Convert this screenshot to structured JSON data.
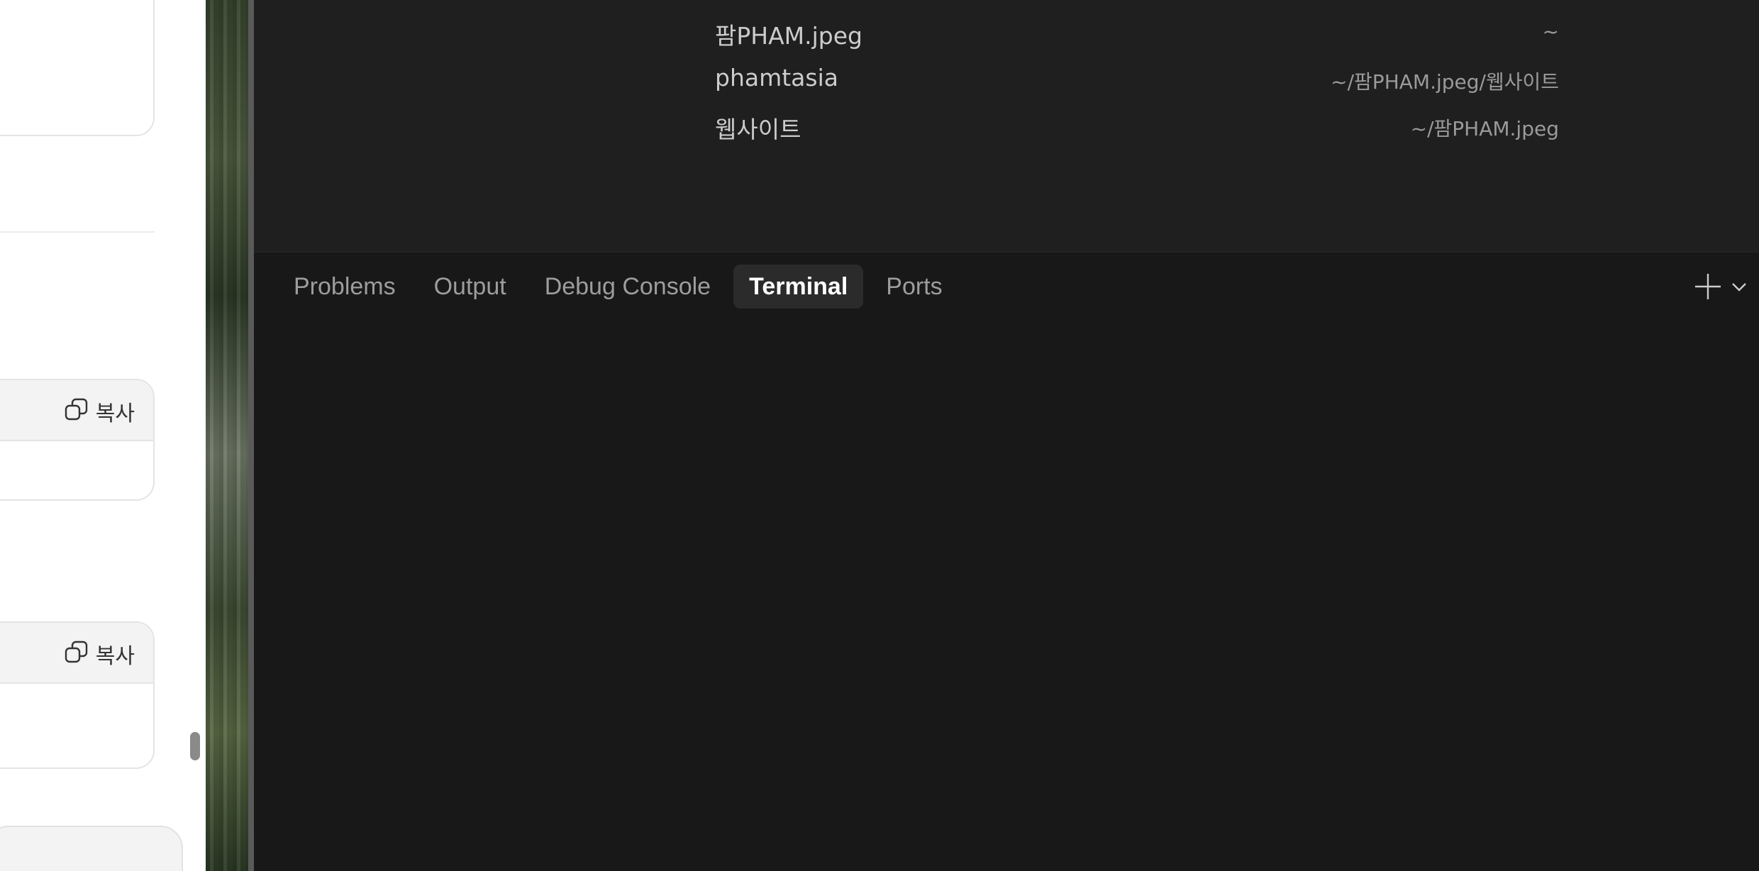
{
  "left_pane": {
    "code_blocks": [
      {
        "copy_label": "복사",
        "icon": "copy-icon"
      },
      {
        "copy_label": "복사",
        "icon": "copy-icon"
      }
    ]
  },
  "quick_pick": {
    "items": [
      {
        "name": "팜PHAM.jpeg",
        "path": "~"
      },
      {
        "name": "phamtasia",
        "path": "~/팜PHAM.jpeg/웹사이트"
      },
      {
        "name": "웹사이트",
        "path": "~/팜PHAM.jpeg"
      }
    ]
  },
  "panel": {
    "tabs": [
      {
        "label": "Problems",
        "active": false
      },
      {
        "label": "Output",
        "active": false
      },
      {
        "label": "Debug Console",
        "active": false
      },
      {
        "label": "Terminal",
        "active": true
      },
      {
        "label": "Ports",
        "active": false
      }
    ],
    "actions": {
      "new_terminal_icon": "plus-icon",
      "dropdown_icon": "chevron-down-icon"
    }
  },
  "colors": {
    "editor_bg": "#181818",
    "quick_pick_bg": "#1f1f1f",
    "active_tab_bg": "#2b2b2b"
  }
}
